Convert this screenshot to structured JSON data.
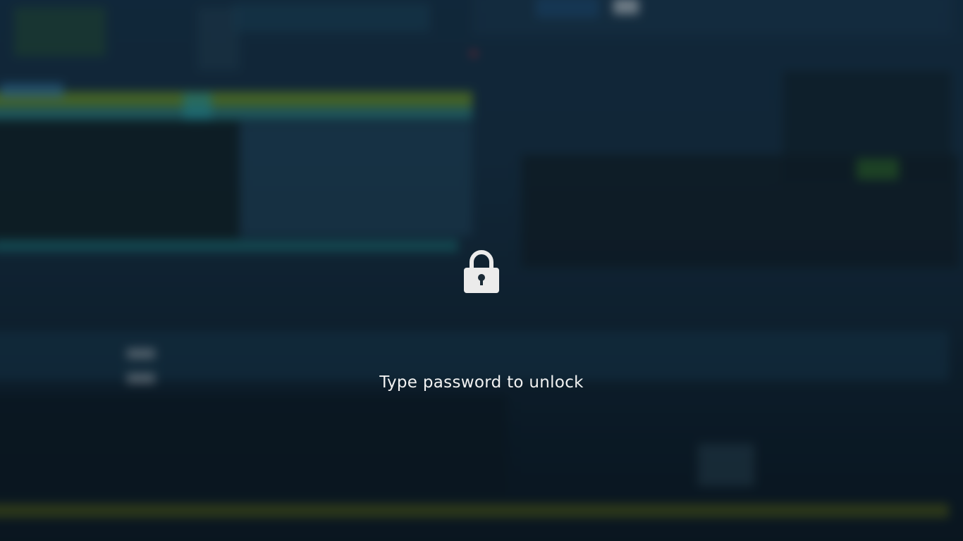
{
  "lock_screen": {
    "icon": "padlock-icon",
    "message": "Type password to unlock"
  },
  "colors": {
    "background": "#0f2231",
    "text": "#f2f2f2",
    "icon": "#ebebeb"
  }
}
